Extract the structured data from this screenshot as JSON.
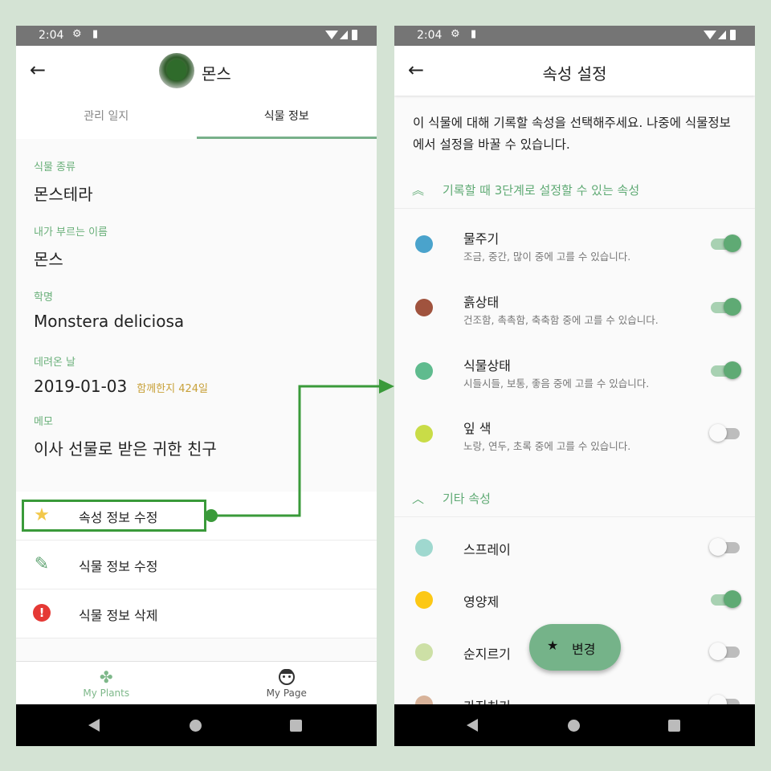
{
  "left": {
    "status_time": "2:04",
    "title": "몬스",
    "tabs": [
      "관리 일지",
      "식물 정보"
    ],
    "fields": [
      {
        "label": "식물 종류",
        "value": "몬스테라"
      },
      {
        "label": "내가 부르는 이름",
        "value": "몬스"
      },
      {
        "label": "학명",
        "value": "Monstera deliciosa"
      },
      {
        "label": "데려온 날",
        "value": "2019-01-03",
        "extra": "함께한지 424일"
      },
      {
        "label": "메모",
        "value": "이사 선물로 받은 귀한 친구"
      }
    ],
    "actions": [
      {
        "label": "속성 정보 수정",
        "icon": "star-icon"
      },
      {
        "label": "식물 정보 수정",
        "icon": "pencil-icon"
      },
      {
        "label": "식물 정보 삭제",
        "icon": "alert-icon"
      }
    ],
    "bottom_nav": [
      {
        "label": "My Plants",
        "icon": "clover-icon"
      },
      {
        "label": "My Page",
        "icon": "face-icon"
      }
    ]
  },
  "right": {
    "status_time": "2:04",
    "title": "속성 설정",
    "description": "이 식물에 대해 기록할 속성을 선택해주세요. 나중에 식물정보에서 설정을 바꿀 수 있습니다.",
    "groups": [
      {
        "label": "기록할 때 3단계로 설정할 수 있는 속성",
        "chevron": "double-chevron-up-icon",
        "items": [
          {
            "name": "물주기",
            "desc": "조금, 중간, 많이 중에 고를 수 있습니다.",
            "color": "#4aa3cc",
            "on": true
          },
          {
            "name": "흙상태",
            "desc": "건조함, 촉촉함, 축축함 중에 고를 수 있습니다.",
            "color": "#a0533e",
            "on": true
          },
          {
            "name": "식물상태",
            "desc": "시들시들, 보통, 좋음 중에 고를 수 있습니다.",
            "color": "#5fbb8e",
            "on": true
          },
          {
            "name": "잎 색",
            "desc": "노랑, 연두, 초록 중에 고를 수 있습니다.",
            "color": "#c9dc47",
            "on": false
          }
        ]
      },
      {
        "label": "기타 속성",
        "chevron": "chevron-up-icon",
        "items": [
          {
            "name": "스프레이",
            "color": "#9fd8cf",
            "on": false
          },
          {
            "name": "영양제",
            "color": "#fcc815",
            "on": true
          },
          {
            "name": "순지르기",
            "color": "#cde0a6",
            "on": false
          },
          {
            "name": "가지치기",
            "color": "#d8b39a",
            "on": false
          }
        ]
      }
    ],
    "fab_label": "변경"
  }
}
